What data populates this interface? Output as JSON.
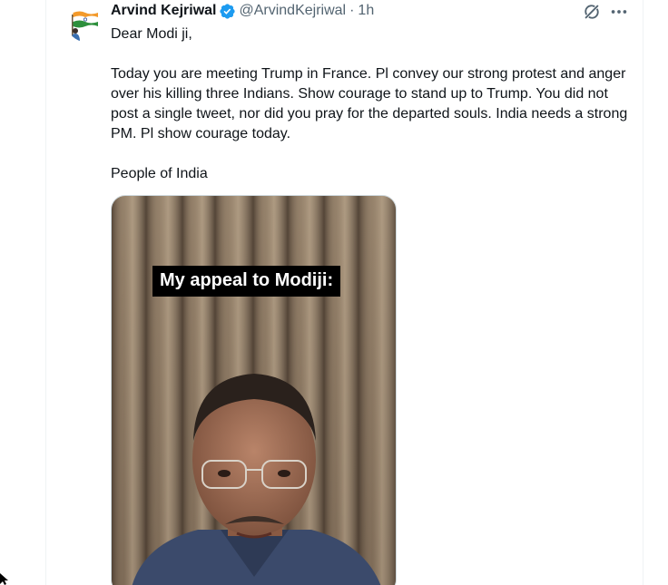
{
  "tweet": {
    "author_name": "Arvind Kejriwal",
    "handle": "@ArvindKejriwal",
    "separator": "·",
    "time": "1h",
    "paragraphs": [
      "Dear Modi ji,",
      "Today you are meeting Trump in France. Pl convey our strong protest and anger over his killing three Indians. Show courage to stand up to Trump. You did not post a single tweet, nor did you pray for the departed souls. India needs a strong PM. Pl show courage today.",
      "People of India"
    ],
    "media": {
      "caption": "My appeal to Modiji:"
    }
  },
  "icons": {
    "avatar": "flag-avatar",
    "verified": "verified-badge-icon",
    "grok": "grok-icon",
    "more": "more-options-icon"
  },
  "colors": {
    "text_primary": "#0f1419",
    "text_secondary": "#536471",
    "verified_blue": "#1d9bf0",
    "border": "#eff3f4"
  }
}
